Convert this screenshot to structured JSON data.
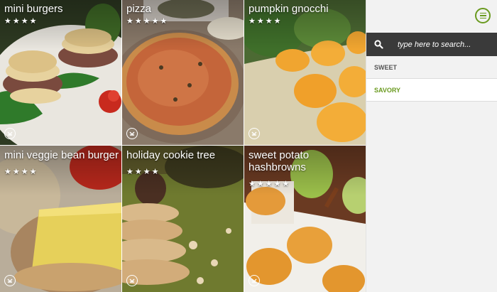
{
  "recipes": [
    {
      "title": "mini burgers",
      "rating": 4,
      "stars": "★★★★",
      "image": "mini burgers with rosemary on plate"
    },
    {
      "title": "pizza",
      "rating": 5,
      "stars": "★★★★★",
      "image": "herb pizza on wooden board"
    },
    {
      "title": "pumpkin gnocchi",
      "rating": 4,
      "stars": "★★★★",
      "image": "orange gnocchi with greens"
    },
    {
      "title": "mini veggie bean burger",
      "rating": 4,
      "stars": "★★★★",
      "image": "bean burger with cheese slice"
    },
    {
      "title": "holiday cookie tree",
      "rating": 4,
      "stars": "★★★★",
      "image": "stacked star cookies"
    },
    {
      "title": "sweet potato hashbrowns",
      "rating": 5,
      "stars": "★★★★★",
      "image": "sweet potato rosettes with apple"
    }
  ],
  "icons": {
    "download": "download-circle-icon",
    "menu": "menu-icon",
    "search": "search-icon"
  },
  "sidebar": {
    "search_placeholder": "type here to search...",
    "categories": [
      {
        "label": "SWEET",
        "selected": false
      },
      {
        "label": "SAVORY",
        "selected": true
      }
    ]
  },
  "colors": {
    "accent": "#6a9a1f",
    "search_bar": "#3a3a3a",
    "sidebar_bg": "#f2f2f2"
  }
}
